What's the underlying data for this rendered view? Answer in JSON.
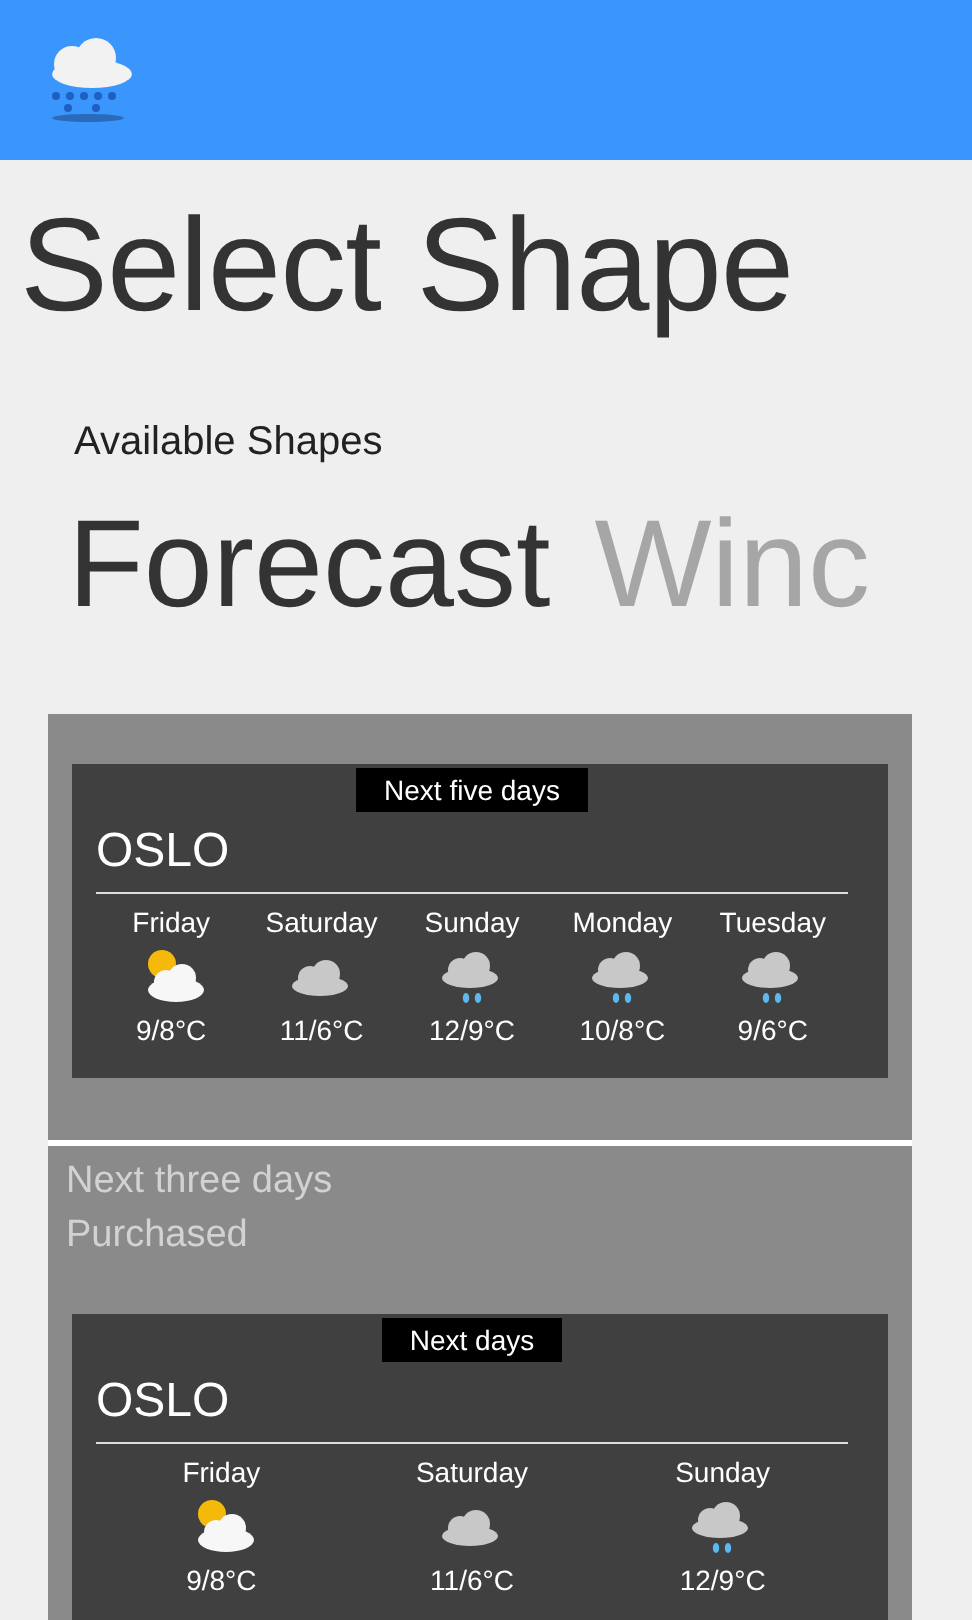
{
  "header": {
    "kind": "app-bar"
  },
  "title": "Select Shape",
  "subtitle": "Available Shapes",
  "pivot": [
    {
      "label": "Forecast",
      "selected": true
    },
    {
      "label": "Winc",
      "selected": false
    }
  ],
  "shapes": [
    {
      "card": {
        "label": "Next five days",
        "city": "OSLO",
        "days": [
          {
            "day": "Friday",
            "kind": "partly-sunny",
            "temp": "9/8°C"
          },
          {
            "day": "Saturday",
            "kind": "cloudy",
            "temp": "11/6°C"
          },
          {
            "day": "Sunday",
            "kind": "rain",
            "temp": "12/9°C"
          },
          {
            "day": "Monday",
            "kind": "rain",
            "temp": "10/8°C"
          },
          {
            "day": "Tuesday",
            "kind": "rain",
            "temp": "9/6°C"
          }
        ]
      }
    },
    {
      "name": "Next three days",
      "status": "Purchased",
      "card": {
        "label": "Next days",
        "city": "OSLO",
        "days": [
          {
            "day": "Friday",
            "kind": "partly-sunny",
            "temp": "9/8°C"
          },
          {
            "day": "Saturday",
            "kind": "cloudy",
            "temp": "11/6°C"
          },
          {
            "day": "Sunday",
            "kind": "rain",
            "temp": "12/9°C"
          }
        ]
      }
    }
  ]
}
